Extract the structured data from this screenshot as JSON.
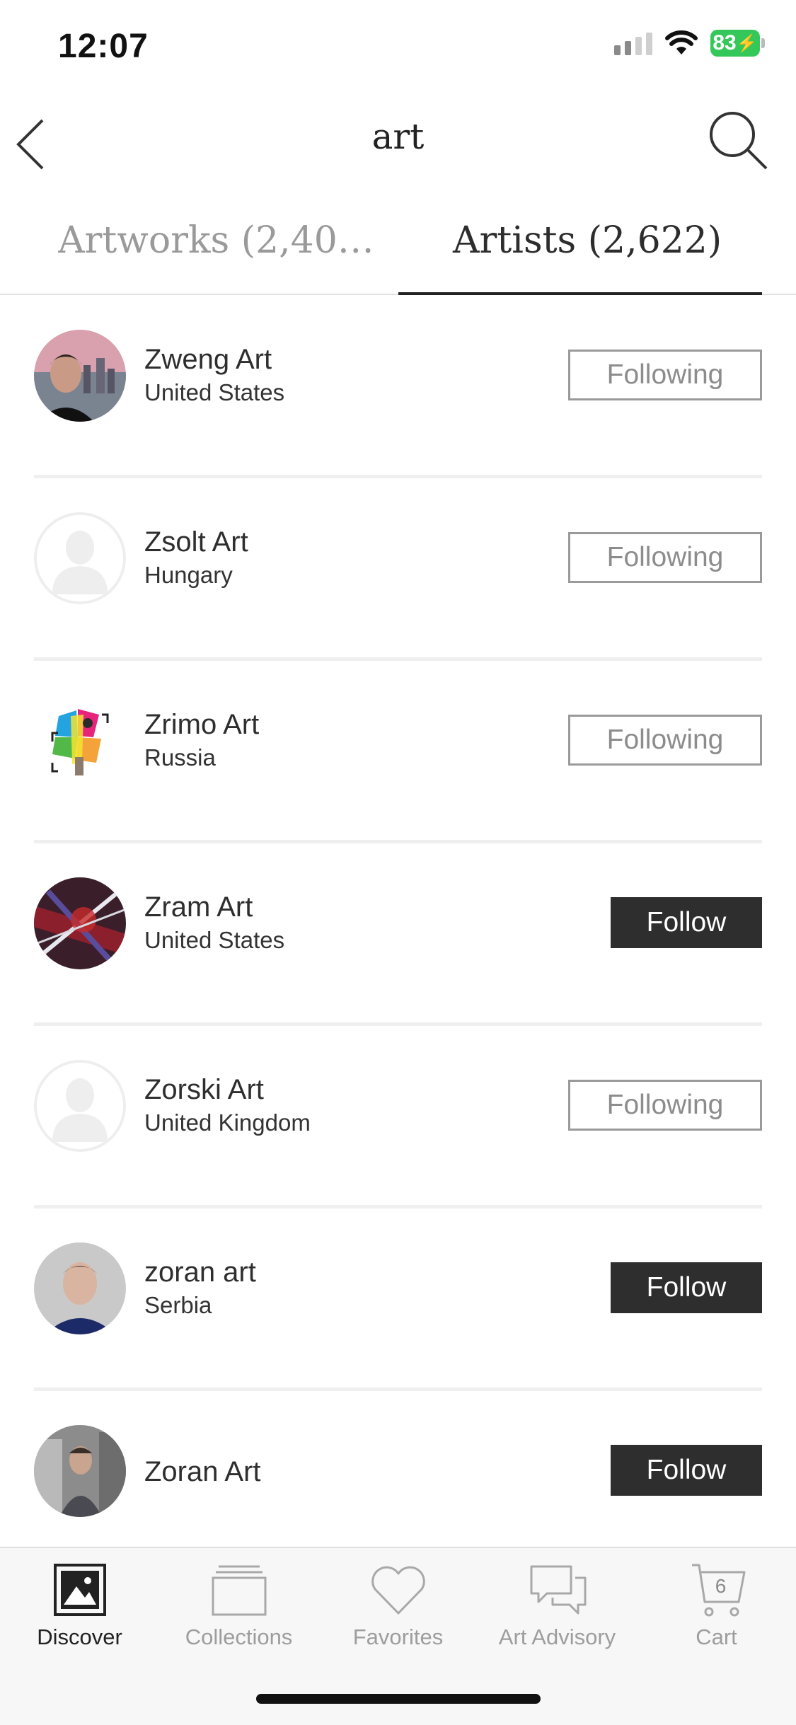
{
  "status_bar": {
    "time": "12:07",
    "battery": "83"
  },
  "nav": {
    "title": "art",
    "back_icon": "chevron-left-icon",
    "search_icon": "search-icon"
  },
  "tabs": [
    {
      "label": "Artworks (2,403,...",
      "active": false
    },
    {
      "label": "Artists (2,622)",
      "active": true
    }
  ],
  "artists": [
    {
      "name": "Zweng Art",
      "country": "United States",
      "button": "Following",
      "state": "following",
      "avatar": "photo"
    },
    {
      "name": "Zsolt Art",
      "country": "Hungary",
      "button": "Following",
      "state": "following",
      "avatar": "placeholder"
    },
    {
      "name": "Zrimo Art",
      "country": "Russia",
      "button": "Following",
      "state": "following",
      "avatar": "logo"
    },
    {
      "name": "Zram Art",
      "country": "United States",
      "button": "Follow",
      "state": "follow",
      "avatar": "photo"
    },
    {
      "name": "Zorski Art",
      "country": "United Kingdom",
      "button": "Following",
      "state": "following",
      "avatar": "placeholder"
    },
    {
      "name": "zoran art",
      "country": "Serbia",
      "button": "Follow",
      "state": "follow",
      "avatar": "photo"
    },
    {
      "name": "Zoran Art",
      "country": "",
      "button": "Follow",
      "state": "follow",
      "avatar": "photo"
    }
  ],
  "tabbar": [
    {
      "label": "Discover",
      "icon": "image-icon",
      "active": true
    },
    {
      "label": "Collections",
      "icon": "collections-icon",
      "active": false
    },
    {
      "label": "Favorites",
      "icon": "heart-icon",
      "active": false
    },
    {
      "label": "Art Advisory",
      "icon": "chat-icon",
      "active": false
    },
    {
      "label": "Cart",
      "icon": "cart-icon",
      "active": false,
      "badge": "6"
    }
  ],
  "colors": {
    "accent": "#2e2e2e",
    "battery": "#34c759"
  }
}
